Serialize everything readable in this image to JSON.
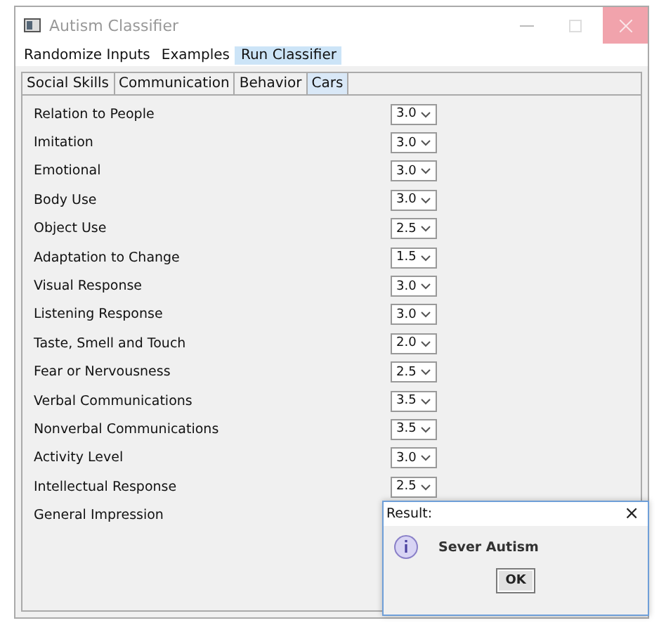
{
  "window": {
    "title": "Autism Classifier"
  },
  "menu": [
    {
      "label": "Randomize Inputs",
      "selected": false
    },
    {
      "label": "Examples",
      "selected": false
    },
    {
      "label": "Run Classifier",
      "selected": true
    }
  ],
  "tabs": [
    {
      "label": "Social Skills",
      "selected": false
    },
    {
      "label": "Communication",
      "selected": false
    },
    {
      "label": "Behavior",
      "selected": false
    },
    {
      "label": "Cars",
      "selected": true
    }
  ],
  "items": [
    {
      "label": "Relation to People",
      "value": "3.0"
    },
    {
      "label": "Imitation",
      "value": "3.0"
    },
    {
      "label": "Emotional",
      "value": "3.0"
    },
    {
      "label": "Body Use",
      "value": "3.0"
    },
    {
      "label": "Object Use",
      "value": "2.5"
    },
    {
      "label": "Adaptation to Change",
      "value": "1.5"
    },
    {
      "label": "Visual Response",
      "value": "3.0"
    },
    {
      "label": "Listening Response",
      "value": "3.0"
    },
    {
      "label": "Taste, Smell and Touch",
      "value": "2.0"
    },
    {
      "label": "Fear or Nervousness",
      "value": "2.5"
    },
    {
      "label": "Verbal Communications",
      "value": "3.5"
    },
    {
      "label": "Nonverbal Communications",
      "value": "3.5"
    },
    {
      "label": "Activity Level",
      "value": "3.0"
    },
    {
      "label": "Intellectual Response",
      "value": "2.5"
    },
    {
      "label": "General Impression"
    }
  ],
  "dialog": {
    "title": "Result:",
    "close": "×",
    "message": "Sever Autism",
    "button": "OK"
  }
}
